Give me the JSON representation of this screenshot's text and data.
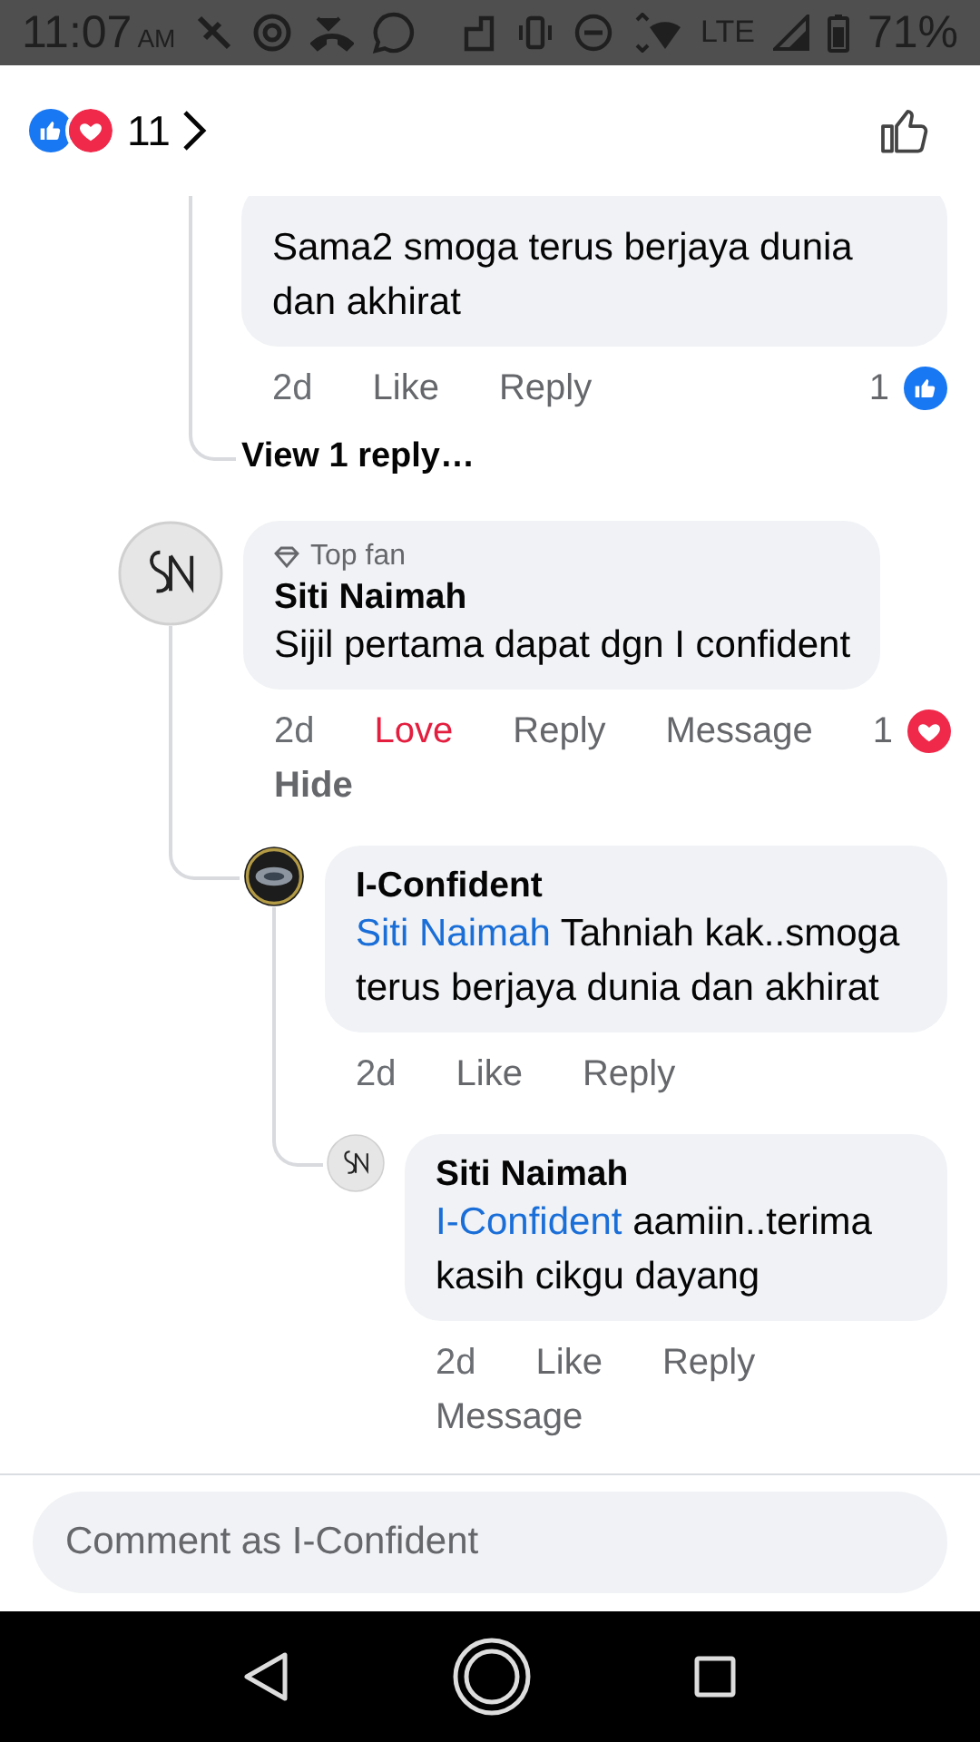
{
  "status_bar": {
    "time": "11:07",
    "meridiem": "AM",
    "network": "LTE",
    "battery": "71%"
  },
  "reactions_bar": {
    "reactions": [
      {
        "kind": "like"
      },
      {
        "kind": "love"
      }
    ],
    "count": "11"
  },
  "partial_thread": {
    "replies": [
      {
        "text": "Sama2 smoga terus berjaya dunia dan akhirat",
        "reaction": {
          "kind": "like",
          "count": "1"
        },
        "action_rows": [
          [
            {
              "label": "2d",
              "kind": "time",
              "active": false
            },
            {
              "label": "Like",
              "kind": "action",
              "active": false
            },
            {
              "label": "Reply",
              "kind": "action",
              "active": false
            }
          ]
        ]
      }
    ],
    "view_replies": "View 1 reply…"
  },
  "comments": [
    {
      "avatar": {
        "kind": "monogram"
      },
      "badge": "Top fan",
      "author": "Siti Naimah",
      "text": "Sijil pertama dapat dgn I confident",
      "reaction": {
        "kind": "love",
        "count": "1"
      },
      "action_rows": [
        [
          {
            "label": "2d",
            "kind": "time",
            "active": false
          },
          {
            "label": "Love",
            "kind": "action",
            "active": true
          },
          {
            "label": "Reply",
            "kind": "action",
            "active": false
          },
          {
            "label": "Message",
            "kind": "action",
            "active": false
          }
        ],
        [
          {
            "label": "Hide",
            "kind": "strong",
            "active": false
          }
        ]
      ],
      "children": [
        {
          "avatar": {
            "kind": "logo"
          },
          "author": "I-Confident",
          "mention": "Siti Naimah",
          "text": "Tahniah kak..smoga terus berjaya dunia dan akhirat",
          "action_rows": [
            [
              {
                "label": "2d",
                "kind": "time",
                "active": false
              },
              {
                "label": "Like",
                "kind": "action",
                "active": false
              },
              {
                "label": "Reply",
                "kind": "action",
                "active": false
              }
            ]
          ],
          "children": [
            {
              "avatar": {
                "kind": "monogram"
              },
              "author": "Siti Naimah",
              "mention": "I-Confident",
              "text": "aamiin..terima kasih cikgu dayang",
              "action_rows": [
                [
                  {
                    "label": "2d",
                    "kind": "time",
                    "active": false
                  },
                  {
                    "label": "Like",
                    "kind": "action",
                    "active": false
                  },
                  {
                    "label": "Reply",
                    "kind": "action",
                    "active": false
                  }
                ],
                [
                  {
                    "label": "Message",
                    "kind": "action",
                    "active": false
                  }
                ]
              ]
            }
          ]
        }
      ]
    }
  ],
  "composer": {
    "placeholder": "Comment as I-Confident"
  }
}
